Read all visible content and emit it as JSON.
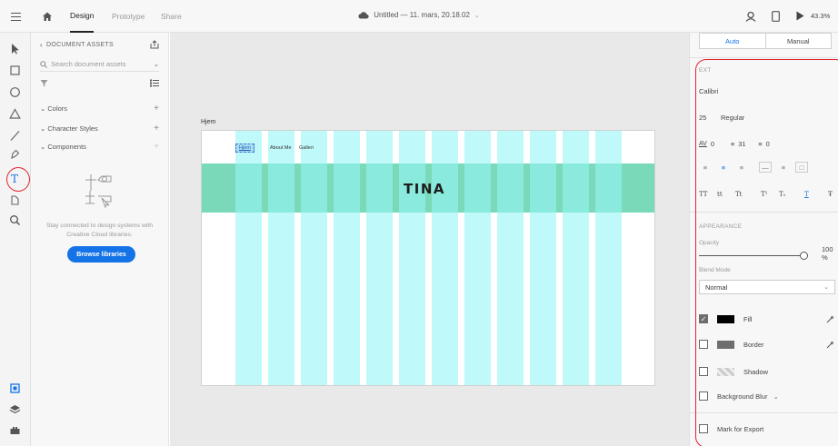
{
  "header": {
    "tabs": [
      {
        "label": "Design",
        "active": true
      },
      {
        "label": "Prototype",
        "active": false
      },
      {
        "label": "Share",
        "active": false
      }
    ],
    "doc_title": "Untitled — 11. mars, 20.18.02",
    "zoom": "43.3%"
  },
  "toolbar": {
    "tools": [
      "select-tool",
      "rectangle-tool",
      "ellipse-tool",
      "polygon-tool",
      "line-tool",
      "pen-tool",
      "text-tool",
      "artboard-tool",
      "zoom-tool"
    ],
    "text_tool_glyph": "T",
    "bottom_tools": [
      "assets-panel",
      "layers-panel",
      "plugins-panel"
    ]
  },
  "assets": {
    "title": "DOCUMENT ASSETS",
    "search_placeholder": "Search document assets",
    "sections": [
      "Colors",
      "Character Styles",
      "Components"
    ],
    "empty_text": "Stay connected to design systems with Creative Cloud libraries.",
    "browse_label": "Browse libraries"
  },
  "canvas": {
    "artboard_title": "Hjem",
    "nav": [
      "Hjem",
      "About Me",
      "Galleri"
    ],
    "logo_text": "TINA",
    "band_color": "#79d9b9",
    "column_color": "#96f5f5",
    "column_count": 12
  },
  "props": {
    "responsive": {
      "auto": "Auto",
      "manual": "Manual"
    },
    "text_label": "EXT",
    "font": "Calibri",
    "font_size": "25",
    "font_weight": "Regular",
    "char_spacing": "0",
    "line_spacing": "31",
    "para_spacing": "0",
    "case_buttons": [
      "TT",
      "tt",
      "Tt",
      "T¹",
      "T₁",
      "T",
      "Ŧ"
    ],
    "appearance_label": "APPEARANCE",
    "opacity_label": "Opacity",
    "opacity_value": "100 %",
    "opacity_fraction": 1.0,
    "blend_label": "Blend Mode",
    "blend_value": "Normal",
    "fill_label": "Fill",
    "fill_color": "#000000",
    "border_label": "Border",
    "border_color": "#6e6e6e",
    "shadow_label": "Shadow",
    "bg_blur_label": "Background Blur",
    "export_label": "Mark for Export"
  },
  "annotation_color": "#e0242a"
}
